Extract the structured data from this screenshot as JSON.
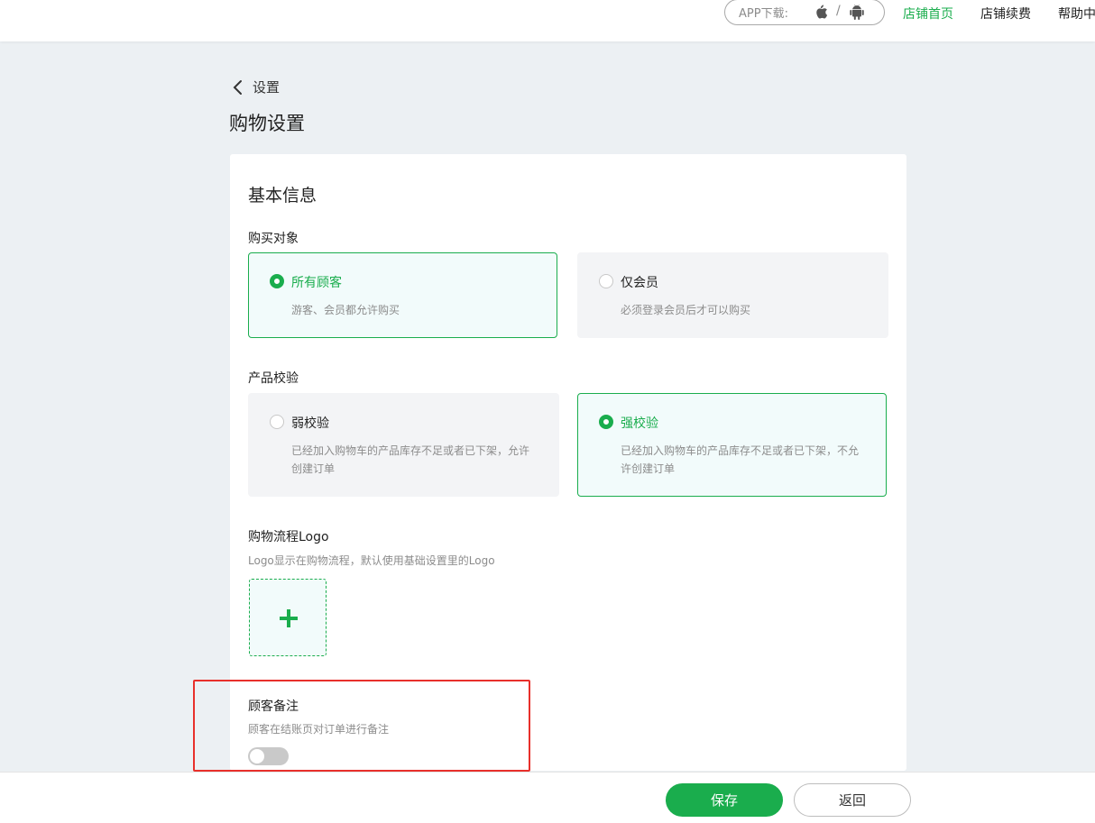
{
  "header": {
    "app_download_label": "APP下载:",
    "separator": "/",
    "nav": [
      {
        "label": "店铺首页",
        "active": true
      },
      {
        "label": "店铺续费",
        "active": false
      },
      {
        "label": "帮助中",
        "active": false
      }
    ]
  },
  "breadcrumb": {
    "back_label": "设置"
  },
  "page_title": "购物设置",
  "card": {
    "section_title": "基本信息",
    "purchase_target": {
      "label": "购买对象",
      "options": [
        {
          "title": "所有顾客",
          "desc": "游客、会员都允许购买",
          "selected": true
        },
        {
          "title": "仅会员",
          "desc": "必须登录会员后才可以购买",
          "selected": false
        }
      ]
    },
    "product_check": {
      "label": "产品校验",
      "options": [
        {
          "title": "弱校验",
          "desc_line1": "已经加入购物车的产品库存不足或者已下架，允许",
          "desc_line2": "创建订单",
          "selected": false
        },
        {
          "title": "强校验",
          "desc_line1": "已经加入购物车的产品库存不足或者已下架，不允",
          "desc_line2": "许创建订单",
          "selected": true
        }
      ]
    },
    "logo": {
      "label": "购物流程Logo",
      "hint": "Logo显示在购物流程，默认使用基础设置里的Logo"
    },
    "customer_note": {
      "label": "顾客备注",
      "hint": "顾客在结账页对订单进行备注",
      "enabled": false
    }
  },
  "footer": {
    "save_label": "保存",
    "back_label": "返回"
  },
  "colors": {
    "accent": "#1aad4d",
    "highlight_border": "#e8302b"
  }
}
